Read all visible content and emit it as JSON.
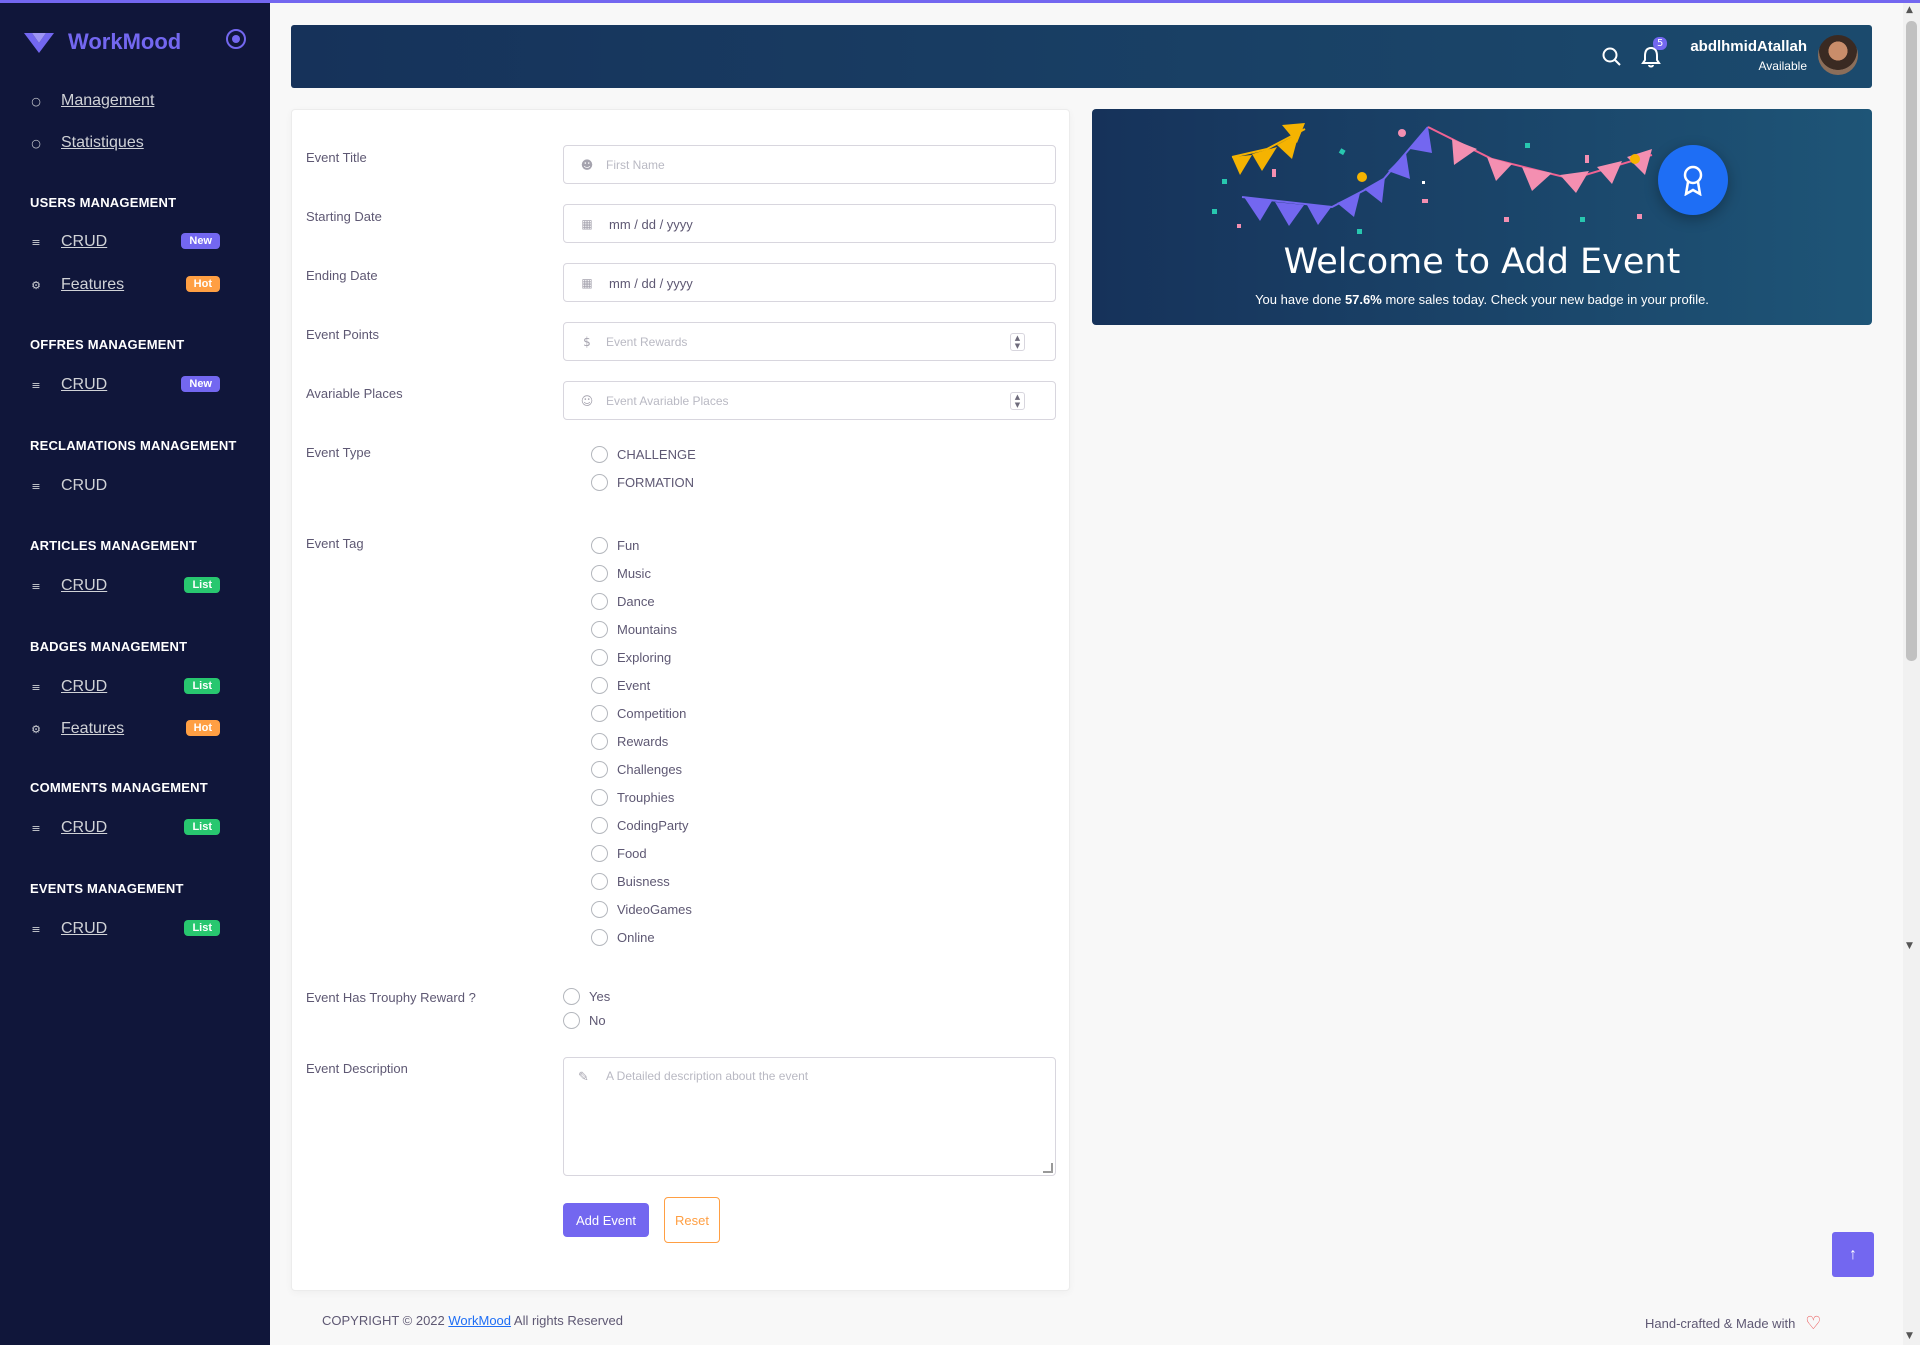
{
  "sidebar": {
    "brand": "WorkMood",
    "top_items": [
      {
        "label": "Management",
        "icon": "circle-icon"
      },
      {
        "label": "Statistiques",
        "icon": "target-icon"
      }
    ],
    "sections": [
      {
        "title": "USERS MANAGEMENT",
        "items": [
          {
            "label": "CRUD",
            "badge": "New",
            "badge_type": "new"
          },
          {
            "label": "Features",
            "badge": "Hot",
            "badge_type": "hot"
          }
        ]
      },
      {
        "title": "OFFRES MANAGEMENT",
        "items": [
          {
            "label": "CRUD",
            "badge": "New",
            "badge_type": "new"
          }
        ]
      },
      {
        "title": "RECLAMATIONS MANAGEMENT",
        "items": [
          {
            "label": "CRUD"
          }
        ]
      },
      {
        "title": "ARTICLES MANAGEMENT",
        "items": [
          {
            "label": "CRUD",
            "badge": "List",
            "badge_type": "list"
          }
        ]
      },
      {
        "title": "BADGES MANAGEMENT",
        "items": [
          {
            "label": "CRUD",
            "badge": "List",
            "badge_type": "list"
          },
          {
            "label": "Features",
            "badge": "Hot",
            "badge_type": "hot"
          }
        ]
      },
      {
        "title": "COMMENTS MANAGEMENT",
        "items": [
          {
            "label": "CRUD",
            "badge": "List",
            "badge_type": "list"
          }
        ]
      },
      {
        "title": "EVENTS MANAGEMENT",
        "items": [
          {
            "label": "CRUD",
            "badge": "List",
            "badge_type": "list"
          }
        ]
      }
    ]
  },
  "navbar": {
    "notification_count": "5",
    "user_name": "abdlhmidAtallah",
    "user_status": "Available"
  },
  "form": {
    "title_label": "Event Title",
    "title_placeholder": "First Name",
    "start_label": "Starting Date",
    "start_placeholder": "mm / dd / yyyy",
    "end_label": "Ending Date",
    "end_placeholder": "mm / dd / yyyy",
    "points_label": "Event Points",
    "points_placeholder": "Event Rewards",
    "places_label": "Avariable Places",
    "places_placeholder": "Event Avariable Places",
    "type_label": "Event Type",
    "types": [
      "CHALLENGE",
      "FORMATION"
    ],
    "tag_label": "Event Tag",
    "tags": [
      "Fun",
      "Music",
      "Dance",
      "Mountains",
      "Exploring",
      "Event",
      "Competition",
      "Rewards",
      "Challenges",
      "Trouphies",
      "CodingParty",
      "Food",
      "Buisness",
      "VideoGames",
      "Online"
    ],
    "reward_label": "Event Has Trouphy Reward ?",
    "reward_options": [
      "Yes",
      "No"
    ],
    "desc_label": "Event Description",
    "desc_placeholder": "A Detailed description about the event",
    "add_button": "Add Event",
    "reset_button": "Reset"
  },
  "welcome": {
    "title": "Welcome to Add Event",
    "sub_prefix": "You have done ",
    "sub_value": "57.6%",
    "sub_suffix": " more sales today. Check your new badge in your profile."
  },
  "footer": {
    "copyright_prefix": "COPYRIGHT © 2022 ",
    "brand_link": "WorkMood",
    "copyright_suffix": " All rights Reserved",
    "made_with": "Hand-crafted & Made with"
  },
  "colors": {
    "primary": "#7367f0",
    "sidebar_bg": "#10163a",
    "badge_new": "#7367f0",
    "badge_hot": "#ff9f43",
    "badge_list": "#28c76f"
  }
}
